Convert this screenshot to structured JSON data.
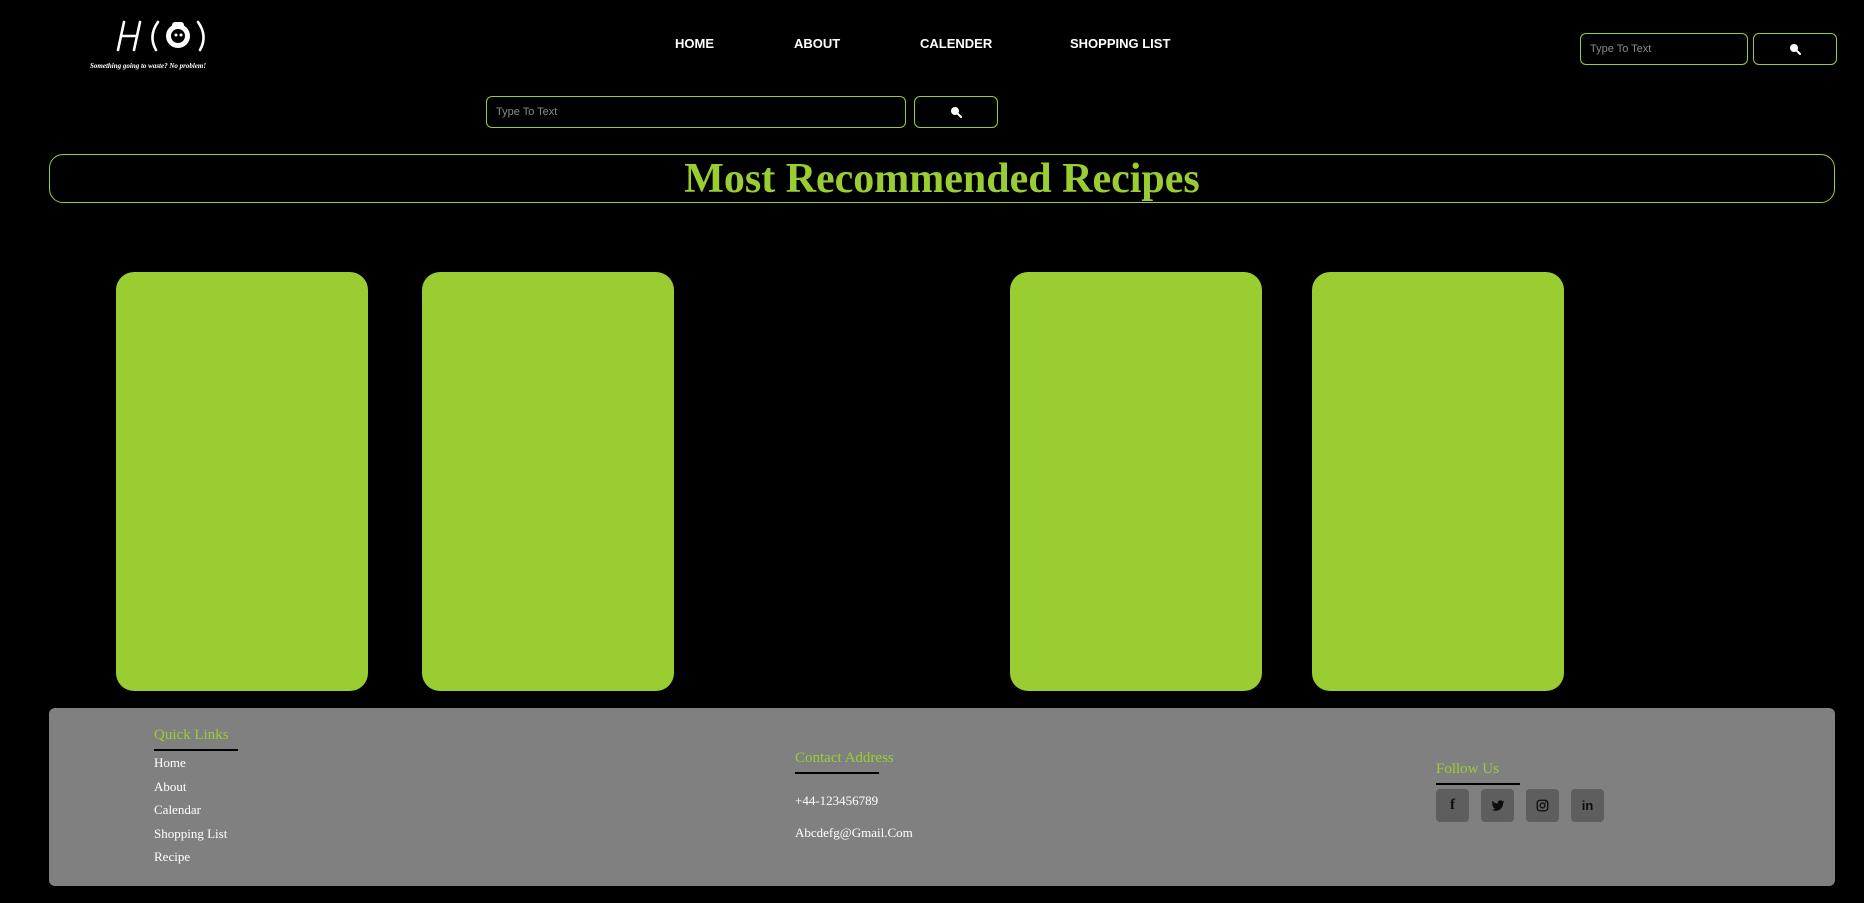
{
  "header": {
    "logo_tagline": "Something going to waste? No problem!",
    "nav": [
      "HOME",
      "ABOUT",
      "CALENDER",
      "SHOPPING LIST"
    ],
    "search_placeholder": "Type To Text"
  },
  "main": {
    "search_placeholder": "Type To Text",
    "title": "Most Recommended Recipes",
    "cards_color": "#9acd32"
  },
  "footer": {
    "quick_links": {
      "heading": "Quick Links",
      "items": [
        "Home",
        "About",
        "Calendar",
        "Shopping List",
        "Recipe"
      ]
    },
    "contact": {
      "heading": "Contact Address",
      "phone": "+44-123456789",
      "email": "Abcdefg@Gmail.Com"
    },
    "follow": {
      "heading": "Follow Us",
      "icons": [
        "facebook-icon",
        "twitter-icon",
        "instagram-icon",
        "linkedin-icon"
      ]
    }
  },
  "colors": {
    "accent": "#9acd32",
    "background": "#000000",
    "footer": "#808080"
  }
}
